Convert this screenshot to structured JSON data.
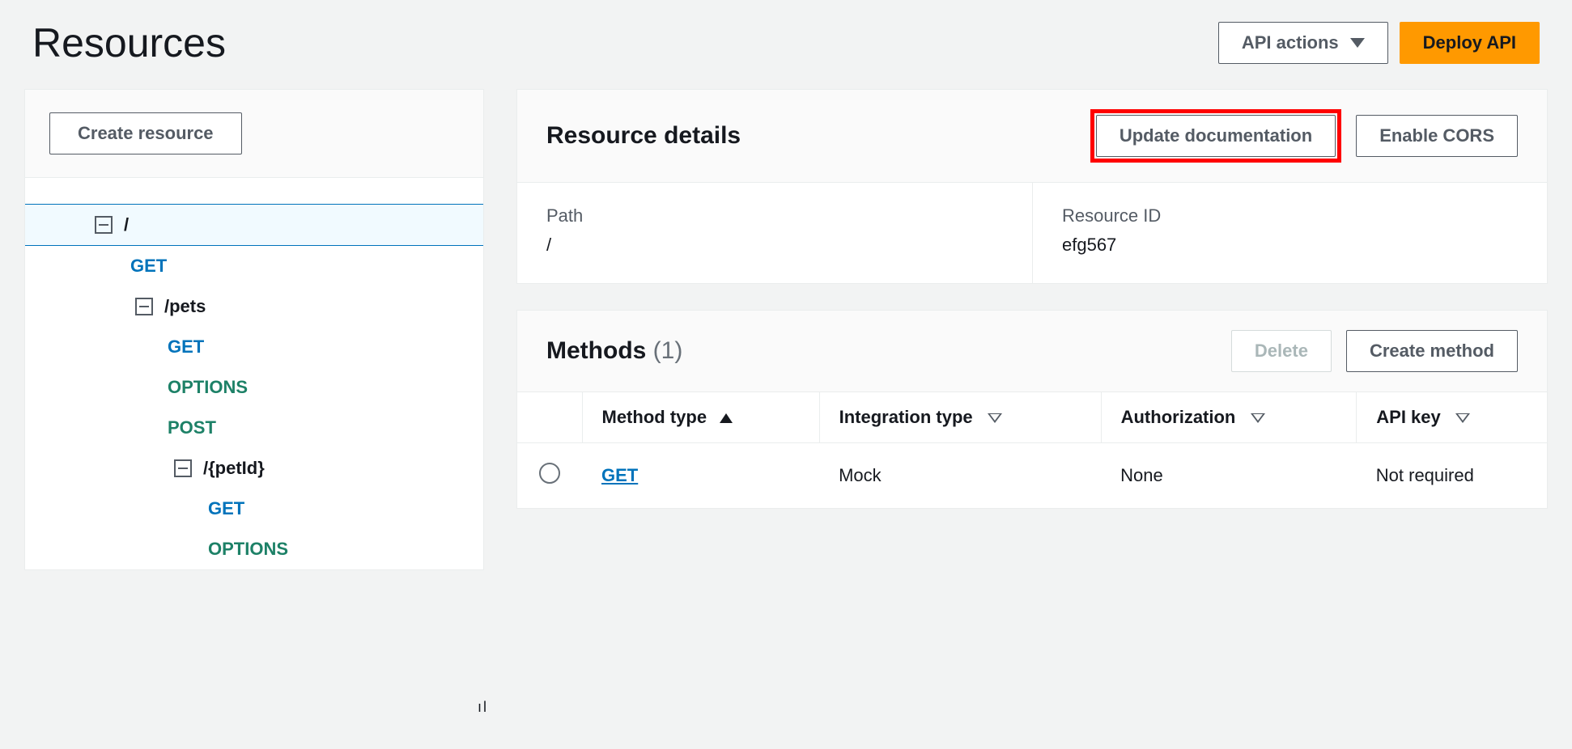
{
  "page": {
    "title": "Resources"
  },
  "topActions": {
    "apiActions": "API actions",
    "deploy": "Deploy API"
  },
  "sidebar": {
    "createResource": "Create resource",
    "tree": {
      "root": "/",
      "rootGet": "GET",
      "pets": "/pets",
      "petsGet": "GET",
      "petsOptions": "OPTIONS",
      "petsPost": "POST",
      "petId": "/{petId}",
      "petIdGet": "GET",
      "petIdOptions": "OPTIONS"
    }
  },
  "details": {
    "title": "Resource details",
    "updateDoc": "Update documentation",
    "enableCors": "Enable CORS",
    "pathLabel": "Path",
    "pathValue": "/",
    "idLabel": "Resource ID",
    "idValue": "efg567"
  },
  "methods": {
    "title": "Methods",
    "count": "(1)",
    "delete": "Delete",
    "create": "Create method",
    "cols": {
      "methodType": "Method type",
      "integrationType": "Integration type",
      "authorization": "Authorization",
      "apiKey": "API key"
    },
    "rows": [
      {
        "method": "GET",
        "integration": "Mock",
        "authorization": "None",
        "apiKey": "Not required"
      }
    ]
  }
}
